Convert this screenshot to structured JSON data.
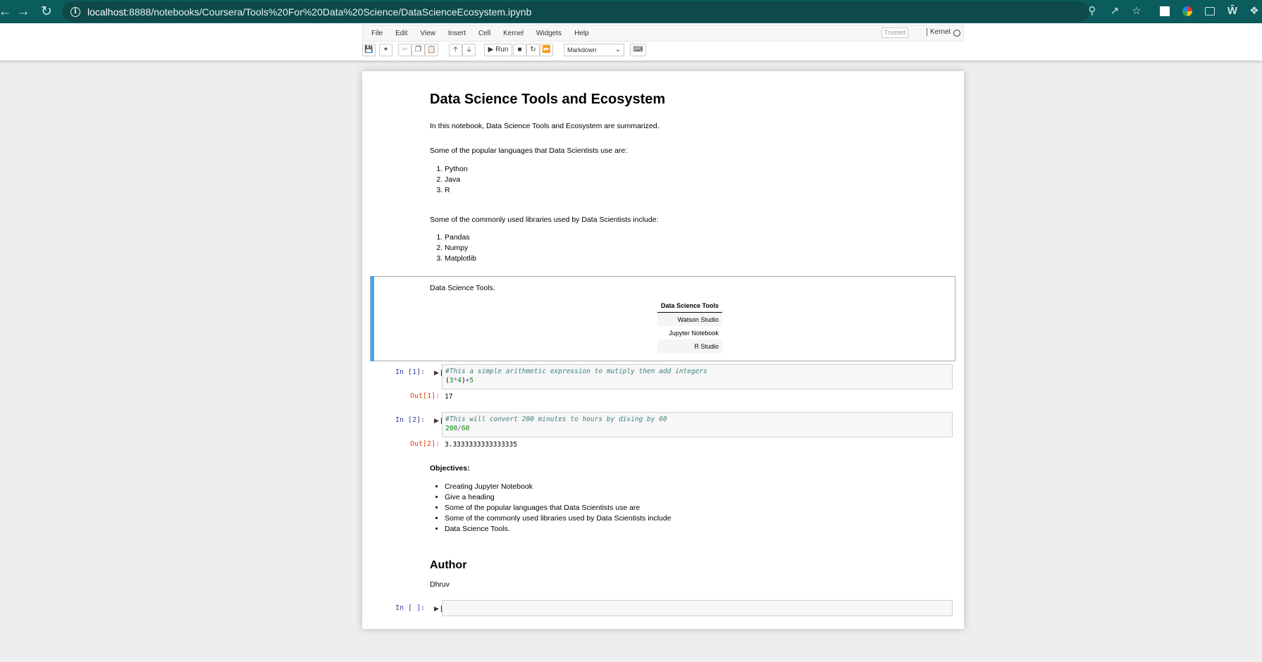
{
  "browser": {
    "url_host": "localhost",
    "url_rest": ":8888/notebooks/Coursera/Tools%20For%20Data%20Science/DataScienceEcosystem.ipynb"
  },
  "menu": [
    "File",
    "Edit",
    "View",
    "Insert",
    "Cell",
    "Kernel",
    "Widgets",
    "Help"
  ],
  "header": {
    "trusted_label": "Trusted",
    "kernel_label": "Kernel"
  },
  "toolbar": {
    "run_label": "Run",
    "cell_type": "Markdown"
  },
  "notebook": {
    "title": "Data Science Tools and Ecosystem",
    "intro": "In this notebook, Data Science Tools and Ecosystem are summarized.",
    "languages_intro": "Some of the popular languages that Data Scientists use are:",
    "languages": [
      "Python",
      "Java",
      "R"
    ],
    "libraries_intro": "Some of the commonly used libraries used by Data Scientists include:",
    "libraries": [
      "Pandas",
      "Numpy",
      "Matplotlib"
    ],
    "tools_intro": "Data Science Tools.",
    "tools_table": {
      "header": "Data Science Tools",
      "rows": [
        "Watson Studio",
        "Jupyter Notebook",
        "R Studio"
      ]
    },
    "cells": [
      {
        "in_prompt": "In [1]:",
        "comment": "#This a simple arithmetic expression to mutiply then add integers",
        "code_a": "(",
        "code_b": "3",
        "code_c": "*",
        "code_d": "4",
        "code_e": ")",
        "code_f": "+",
        "code_g": "5",
        "out_prompt": "Out[1]:",
        "output": "17"
      },
      {
        "in_prompt": "In [2]:",
        "comment": "#This will convert 200 minutes to hours by diving by 60",
        "code_a": "200",
        "code_b": "/",
        "code_c": "60",
        "out_prompt": "Out[2]:",
        "output": "3.3333333333333335"
      }
    ],
    "objectives_heading": "Objectives:",
    "objectives": [
      "Creating Jupyter Notebook",
      "Give a heading",
      "Some of the popular languages that Data Scientists use are",
      "Some of the commonly used libraries used by Data Scientists include",
      "Data Science Tools."
    ],
    "author_heading": "Author",
    "author_name": "Dhruv",
    "empty_prompt": "In [ ]:"
  }
}
